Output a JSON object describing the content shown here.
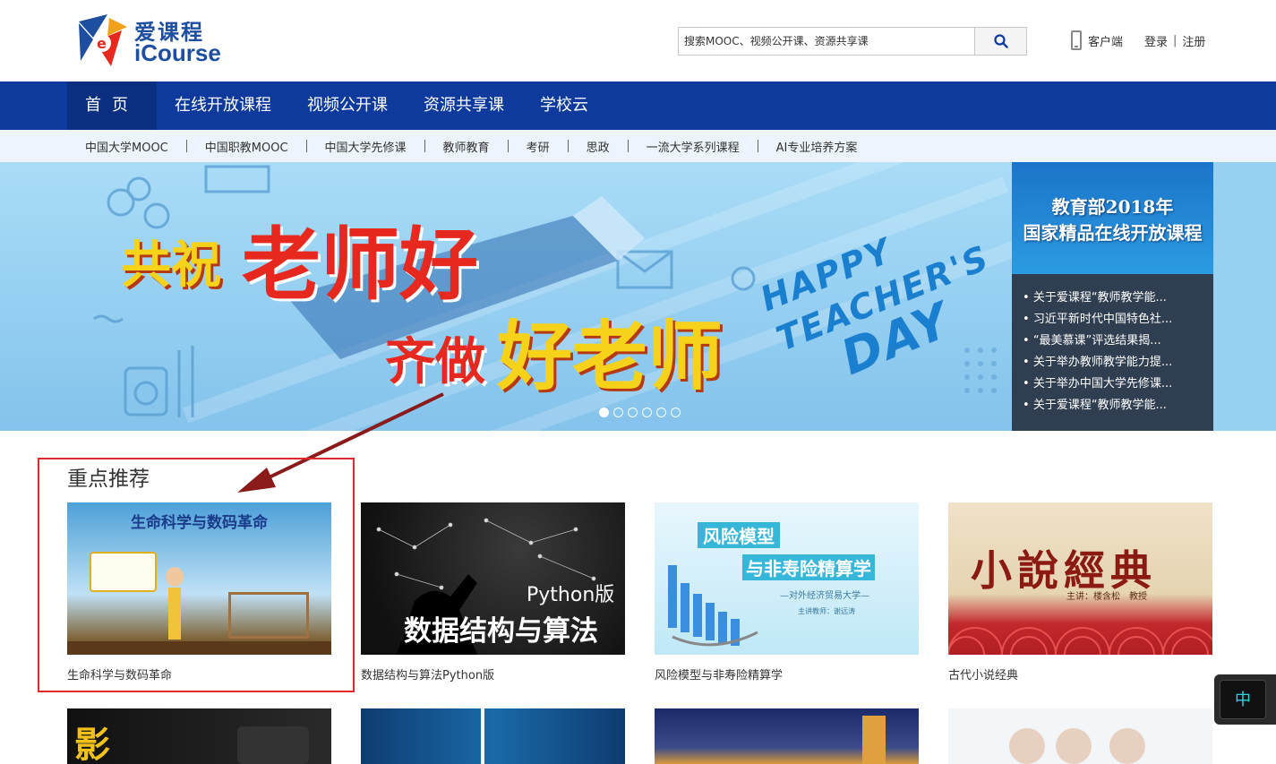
{
  "brand": {
    "name_zh": "爱课程",
    "name_en": "iCourse"
  },
  "search": {
    "placeholder": "搜索MOOC、视频公开课、资源共享课"
  },
  "header": {
    "client": "客户端",
    "login": "登录",
    "separator": "|",
    "register": "注册"
  },
  "main_nav": [
    "首页",
    "在线开放课程",
    "视频公开课",
    "资源共享课",
    "学校云"
  ],
  "sub_nav": [
    "中国大学MOOC",
    "中国职教MOOC",
    "中国大学先修课",
    "教师教育",
    "考研",
    "思政",
    "一流大学系列课程",
    "AI专业培养方案"
  ],
  "banner": {
    "line1a": "共祝",
    "line1b": "老师好",
    "line2a": "齐做",
    "line2b": "好老师",
    "happy_lines": [
      "HAPPY",
      "TEACHER'S",
      "DAY"
    ],
    "dots_count": 6,
    "active_dot": 0
  },
  "promo": {
    "title_line1": "教育部2018年",
    "title_line2": "国家精品在线开放课程",
    "news": [
      "关于爱课程“教师教学能...",
      "习近平新时代中国特色社...",
      "“最美慕课”评选结果揭...",
      "关于举办教师教学能力提...",
      "关于举办中国大学先修课...",
      "关于爱课程“教师教学能..."
    ]
  },
  "featured": {
    "title": "重点推荐",
    "courses": [
      {
        "name": "生命科学与数码革命",
        "thumb_text": "生命科学与数码革命"
      },
      {
        "name": "数据结构与算法Python版",
        "thumb_text_a": "Python版",
        "thumb_text_b": "数据结构与算法"
      },
      {
        "name": "风险模型与非寿险精算学",
        "thumb_text_a": "风险模型",
        "thumb_text_b": "与非寿险精算学",
        "thumb_text_c": "—对外经济贸易大学—",
        "thumb_text_d": "主讲教师：谢远涛"
      },
      {
        "name": "古代小说经典",
        "thumb_text_a": "小說經典",
        "thumb_text_b": "主讲：楼含松　教授"
      }
    ]
  },
  "row2": {
    "thumb1_text": "影"
  },
  "ime": {
    "label": "中"
  },
  "colors": {
    "nav_bg": "#0d3a9c",
    "accent_red": "#e0292b",
    "subnav_bg": "#eef4fb"
  }
}
